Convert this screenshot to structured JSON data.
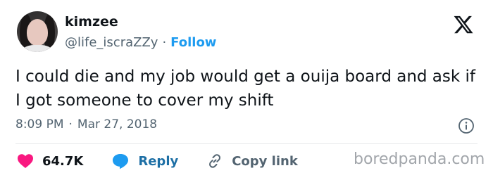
{
  "user": {
    "name": "kimzee",
    "handle": "@life_iscraZZy",
    "separator": "·",
    "follow_label": "Follow"
  },
  "tweet": {
    "text": "I could die and my job would get a ouija board and ask if I got someone to cover my shift",
    "time": "8:09 PM",
    "date_separator": "·",
    "date": "Mar 27, 2018"
  },
  "actions": {
    "likes_count": "64.7K",
    "reply_label": "Reply",
    "copy_link_label": "Copy link"
  },
  "icons": {
    "logo": "x-logo-icon",
    "info": "info-icon",
    "like": "heart-icon",
    "reply": "speech-bubble-icon",
    "copy": "link-icon"
  },
  "colors": {
    "accent": "#1d9bf0",
    "like": "#f91880",
    "muted": "#536471"
  },
  "watermark": "boredpanda.com"
}
